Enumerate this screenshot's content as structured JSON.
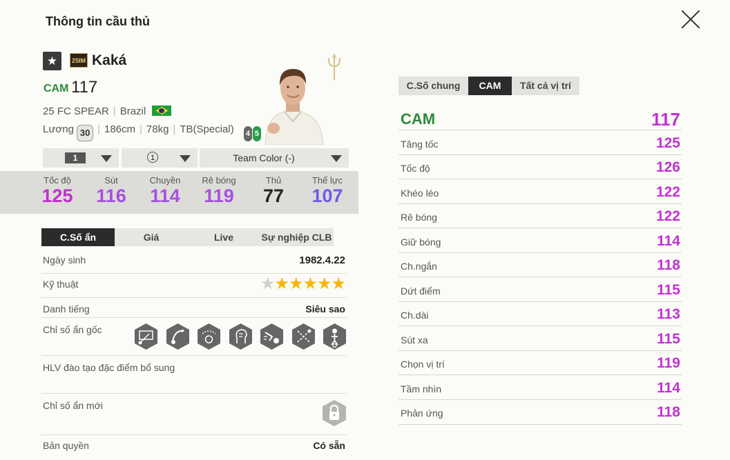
{
  "window": {
    "title": "Thông tin cầu thủ"
  },
  "player": {
    "season_badge": "25IM",
    "name": "Kaká",
    "position": "CAM",
    "ovr": "117",
    "season": "25 FC SPEAR",
    "nation": "Brazil",
    "salary_label": "Lương",
    "salary": "30",
    "height": "186cm",
    "weight": "78kg",
    "body_type": "TB(Special)",
    "weak_foot": "4",
    "skill_foot": "5"
  },
  "dropdowns": {
    "level": "1",
    "training": "1",
    "team_color": "Team Color (-)"
  },
  "stats": [
    {
      "label": "Tốc độ",
      "value": "125",
      "color": "#c12fd0"
    },
    {
      "label": "Sút",
      "value": "116",
      "color": "#a74fe0"
    },
    {
      "label": "Chuyền",
      "value": "114",
      "color": "#a74fe0"
    },
    {
      "label": "Rê bóng",
      "value": "119",
      "color": "#a74fe0"
    },
    {
      "label": "Thủ",
      "value": "77",
      "color": "#222222"
    },
    {
      "label": "Thể lực",
      "value": "107",
      "color": "#6f5ae8"
    }
  ],
  "left_tabs": [
    "C.Số ẩn",
    "Giá",
    "Live",
    "Sự nghiệp CLB"
  ],
  "details": {
    "birth_label": "Ngày sinh",
    "birth": "1982.4.22",
    "skill_label": "Kỹ thuật",
    "skill_stars": 5,
    "reputation_label": "Danh tiếng",
    "reputation": "Siêu sao",
    "hidden_traits_label": "Chỉ số ẩn gốc",
    "traits": [
      "long-shot-trait-icon",
      "flair-trait-icon",
      "dribbler-trait-icon",
      "playmaker-trait-icon",
      "speed-dribbler-trait-icon",
      "passing-trait-icon",
      "power-header-trait-icon"
    ],
    "coach_label": "HLV đào tạo đặc điểm bổ sung",
    "new_traits_label": "Chỉ số ẩn mới",
    "rights_label": "Bản quyền",
    "rights": "Có sẵn"
  },
  "right_tabs": [
    "C.Số chung",
    "CAM",
    "Tất cả vị trí"
  ],
  "position_stats": {
    "head_label": "CAM",
    "head_value": "117",
    "rows": [
      {
        "label": "Tăng tốc",
        "value": "125"
      },
      {
        "label": "Tốc độ",
        "value": "126"
      },
      {
        "label": "Khéo léo",
        "value": "122"
      },
      {
        "label": "Rê bóng",
        "value": "122"
      },
      {
        "label": "Giữ bóng",
        "value": "114"
      },
      {
        "label": "Ch.ngắn",
        "value": "118"
      },
      {
        "label": "Dứt điểm",
        "value": "115"
      },
      {
        "label": "Ch.dài",
        "value": "113"
      },
      {
        "label": "Sút xa",
        "value": "115"
      },
      {
        "label": "Chọn vị trí",
        "value": "119"
      },
      {
        "label": "Tầm nhìn",
        "value": "114"
      },
      {
        "label": "Phản ứng",
        "value": "118"
      }
    ]
  }
}
